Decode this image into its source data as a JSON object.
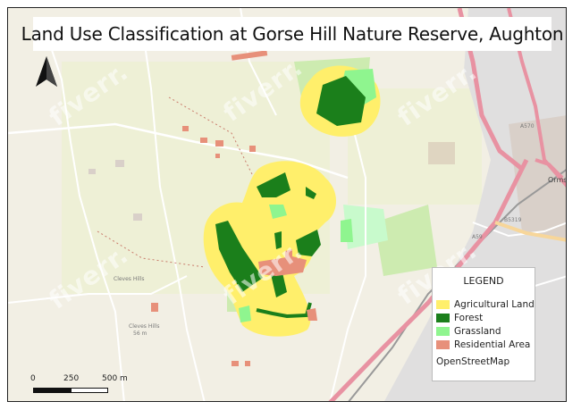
{
  "map": {
    "title": "Land Use Classification at Gorse Hill Nature Reserve, Aughton",
    "north_arrow_icon": "north-arrow-icon",
    "basemap_colors": {
      "land": "#f2efe4",
      "farmland": "#eef0d6",
      "grass": "#cdebb0",
      "park": "#c8facc",
      "residential": "#e0dfdf",
      "road_major": "#e892a2",
      "road_minor": "#ffffff",
      "railway": "#999999"
    }
  },
  "legend": {
    "title": "LEGEND",
    "items": [
      {
        "label": "Agricultural Land",
        "color": "#ffef6b"
      },
      {
        "label": "Forest",
        "color": "#1b7f1b"
      },
      {
        "label": "Grassland",
        "color": "#8ff58f"
      },
      {
        "label": "Residential Area",
        "color": "#e7907a"
      }
    ],
    "source": "OpenStreetMap"
  },
  "scalebar": {
    "zero": "0",
    "mid": "250",
    "end": "500 m"
  },
  "labels": {
    "cleves_hills": "Cleves Hills",
    "cleves_hills_marker": "Cleves Hills",
    "cleves_hills_elev": "56 m",
    "road_a570": "A570",
    "road_a59": "A59",
    "road_b5319": "B5319",
    "ormskirk": "Ormsk"
  },
  "watermark": "fiverr."
}
